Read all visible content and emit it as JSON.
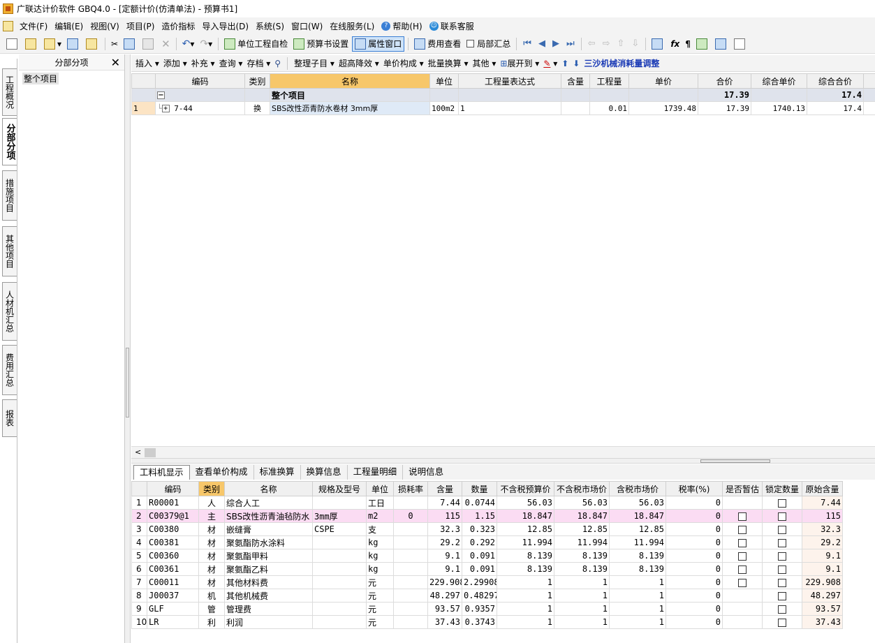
{
  "window": {
    "title": "广联达计价软件 GBQ4.0 - [定额计价(仿清单法) - 预算书1]"
  },
  "menu": [
    "文件(F)",
    "编辑(E)",
    "视图(V)",
    "项目(P)",
    "造价指标",
    "导入导出(D)",
    "系统(S)",
    "窗口(W)",
    "在线服务(L)",
    "帮助(H)",
    "联系客服"
  ],
  "toolbar": {
    "check": "单位工程自检",
    "budget_settings": "预算书设置",
    "property_window": "属性窗口",
    "fee_view": "费用查看",
    "partial_summary": "局部汇总"
  },
  "side_tabs": [
    "工程概况",
    "分部分项",
    "措施项目",
    "其他项目",
    "人材机汇总",
    "费用汇总",
    "报表"
  ],
  "left_pane": {
    "title": "分部分项",
    "item": "整个项目"
  },
  "toolbar2": [
    "插入",
    "添加",
    "补充",
    "查询",
    "存档",
    "整理子目",
    "超高降效",
    "单价构成",
    "批量换算",
    "其他",
    "展开到"
  ],
  "toolbar2_link": "三沙机械消耗量调整",
  "top_grid": {
    "headers": [
      "编码",
      "类别",
      "名称",
      "单位",
      "工程量表达式",
      "含量",
      "工程量",
      "单价",
      "合价",
      "综合单价",
      "综合合价"
    ],
    "group": {
      "name": "整个项目",
      "total": "17.39",
      "comp_total": "17.4"
    },
    "rows": [
      {
        "no": "1",
        "code": "7-44",
        "type": "换",
        "name": "SBS改性沥青防水卷材 3mm厚",
        "unit": "100m2",
        "expr": "1",
        "content": "",
        "qty": "0.01",
        "price": "1739.48",
        "total": "17.39",
        "comp_price": "1740.13",
        "comp_total": "17.4"
      }
    ]
  },
  "bottom_tabs": [
    "工料机显示",
    "查看单价构成",
    "标准换算",
    "换算信息",
    "工程量明细",
    "说明信息"
  ],
  "bottom_grid": {
    "headers": [
      "编码",
      "类别",
      "名称",
      "规格及型号",
      "单位",
      "损耗率",
      "含量",
      "数量",
      "不含税预算价",
      "不含税市场价",
      "含税市场价",
      "税率(%)",
      "是否暂估",
      "锁定数量",
      "原始含量"
    ],
    "rows": [
      {
        "no": "1",
        "code": "R00001",
        "type": "人",
        "name": "综合人工",
        "spec": "",
        "unit": "工日",
        "loss": "",
        "content": "7.44",
        "qty": "0.0744",
        "p1": "56.03",
        "p2": "56.03",
        "p3": "56.03",
        "tax": "0",
        "est": false,
        "lock": true,
        "orig": "7.44"
      },
      {
        "no": "2",
        "code": "C00379@1",
        "type": "主",
        "name": "SBS改性沥青油毡防水",
        "spec": "3mm厚",
        "unit": "m2",
        "loss": "0",
        "content": "115",
        "qty": "1.15",
        "p1": "18.847",
        "p2": "18.847",
        "p3": "18.847",
        "tax": "0",
        "est": true,
        "lock": true,
        "orig": "115"
      },
      {
        "no": "3",
        "code": "C00380",
        "type": "材",
        "name": "嵌缝膏",
        "spec": "CSPE",
        "unit": "支",
        "loss": "",
        "content": "32.3",
        "qty": "0.323",
        "p1": "12.85",
        "p2": "12.85",
        "p3": "12.85",
        "tax": "0",
        "est": true,
        "lock": true,
        "orig": "32.3"
      },
      {
        "no": "4",
        "code": "C00381",
        "type": "材",
        "name": "聚氨酯防水涂料",
        "spec": "",
        "unit": "kg",
        "loss": "",
        "content": "29.2",
        "qty": "0.292",
        "p1": "11.994",
        "p2": "11.994",
        "p3": "11.994",
        "tax": "0",
        "est": true,
        "lock": true,
        "orig": "29.2"
      },
      {
        "no": "5",
        "code": "C00360",
        "type": "材",
        "name": "聚氨酯甲料",
        "spec": "",
        "unit": "kg",
        "loss": "",
        "content": "9.1",
        "qty": "0.091",
        "p1": "8.139",
        "p2": "8.139",
        "p3": "8.139",
        "tax": "0",
        "est": true,
        "lock": true,
        "orig": "9.1"
      },
      {
        "no": "6",
        "code": "C00361",
        "type": "材",
        "name": "聚氨酯乙料",
        "spec": "",
        "unit": "kg",
        "loss": "",
        "content": "9.1",
        "qty": "0.091",
        "p1": "8.139",
        "p2": "8.139",
        "p3": "8.139",
        "tax": "0",
        "est": true,
        "lock": true,
        "orig": "9.1"
      },
      {
        "no": "7",
        "code": "C00011",
        "type": "材",
        "name": "其他材料费",
        "spec": "",
        "unit": "元",
        "loss": "",
        "content": "229.908",
        "qty": "2.29908",
        "p1": "1",
        "p2": "1",
        "p3": "1",
        "tax": "0",
        "est": true,
        "lock": true,
        "orig": "229.908"
      },
      {
        "no": "8",
        "code": "J00037",
        "type": "机",
        "name": "其他机械费",
        "spec": "",
        "unit": "元",
        "loss": "",
        "content": "48.297",
        "qty": "0.48297",
        "p1": "1",
        "p2": "1",
        "p3": "1",
        "tax": "0",
        "est": false,
        "lock": true,
        "orig": "48.297"
      },
      {
        "no": "9",
        "code": "GLF",
        "type": "管",
        "name": "管理费",
        "spec": "",
        "unit": "元",
        "loss": "",
        "content": "93.57",
        "qty": "0.9357",
        "p1": "1",
        "p2": "1",
        "p3": "1",
        "tax": "0",
        "est": false,
        "lock": true,
        "orig": "93.57"
      },
      {
        "no": "10",
        "code": "LR",
        "type": "利",
        "name": "利润",
        "spec": "",
        "unit": "元",
        "loss": "",
        "content": "37.43",
        "qty": "0.3743",
        "p1": "1",
        "p2": "1",
        "p3": "1",
        "tax": "0",
        "est": false,
        "lock": true,
        "orig": "37.43"
      }
    ]
  }
}
